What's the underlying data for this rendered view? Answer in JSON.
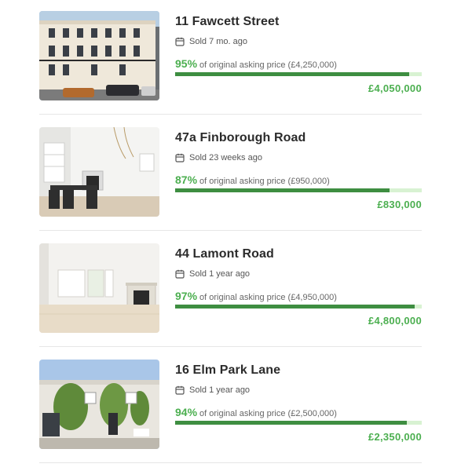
{
  "listings": [
    {
      "title": "11 Fawcett Street",
      "sold": "Sold 7 mo. ago",
      "pct_label": "95%",
      "pct_value": 95,
      "asking_text": "of original asking price (£4,250,000)",
      "price": "£4,050,000"
    },
    {
      "title": "47a Finborough Road",
      "sold": "Sold 23 weeks ago",
      "pct_label": "87%",
      "pct_value": 87,
      "asking_text": "of original asking price (£950,000)",
      "price": "£830,000"
    },
    {
      "title": "44 Lamont Road",
      "sold": "Sold 1 year ago",
      "pct_label": "97%",
      "pct_value": 97,
      "asking_text": "of original asking price (£4,950,000)",
      "price": "£4,800,000"
    },
    {
      "title": "16 Elm Park Lane",
      "sold": "Sold 1 year ago",
      "pct_label": "94%",
      "pct_value": 94,
      "asking_text": "of original asking price (£2,500,000)",
      "price": "£2,350,000"
    }
  ],
  "colors": {
    "accent_green": "#4caf50",
    "bar_fill": "#3e8e41",
    "bar_track": "#d8f2d2"
  },
  "icons": {
    "sold_date": "calendar-icon"
  }
}
